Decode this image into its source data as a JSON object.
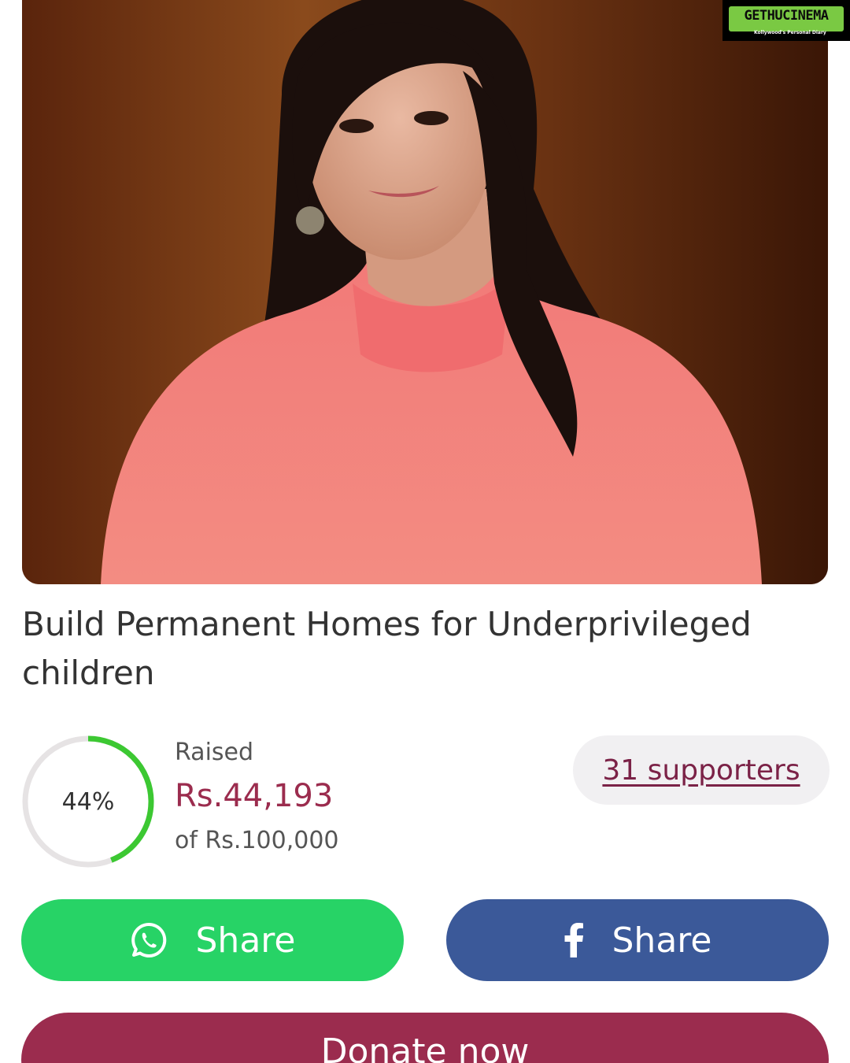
{
  "watermark": {
    "brand": "GETHUCINEMA",
    "tagline": "Kollywood's Personal Diary"
  },
  "campaign": {
    "title": "Build Permanent Homes for Underprivileged children"
  },
  "progress": {
    "percent_label": "44%",
    "percent": 44,
    "raised_label": "Raised",
    "raised_amount": "Rs.44,193",
    "goal": "of Rs.100,000",
    "supporters": "31 supporters"
  },
  "actions": {
    "whatsapp_share": "Share",
    "facebook_share": "Share",
    "donate": "Donate now"
  },
  "icons": {
    "whatsapp": "whatsapp-icon",
    "facebook": "facebook-icon"
  },
  "colors": {
    "accent": "#9b2c4e",
    "progress": "#3cc832",
    "whatsapp": "#27d366",
    "facebook": "#3b5999"
  }
}
